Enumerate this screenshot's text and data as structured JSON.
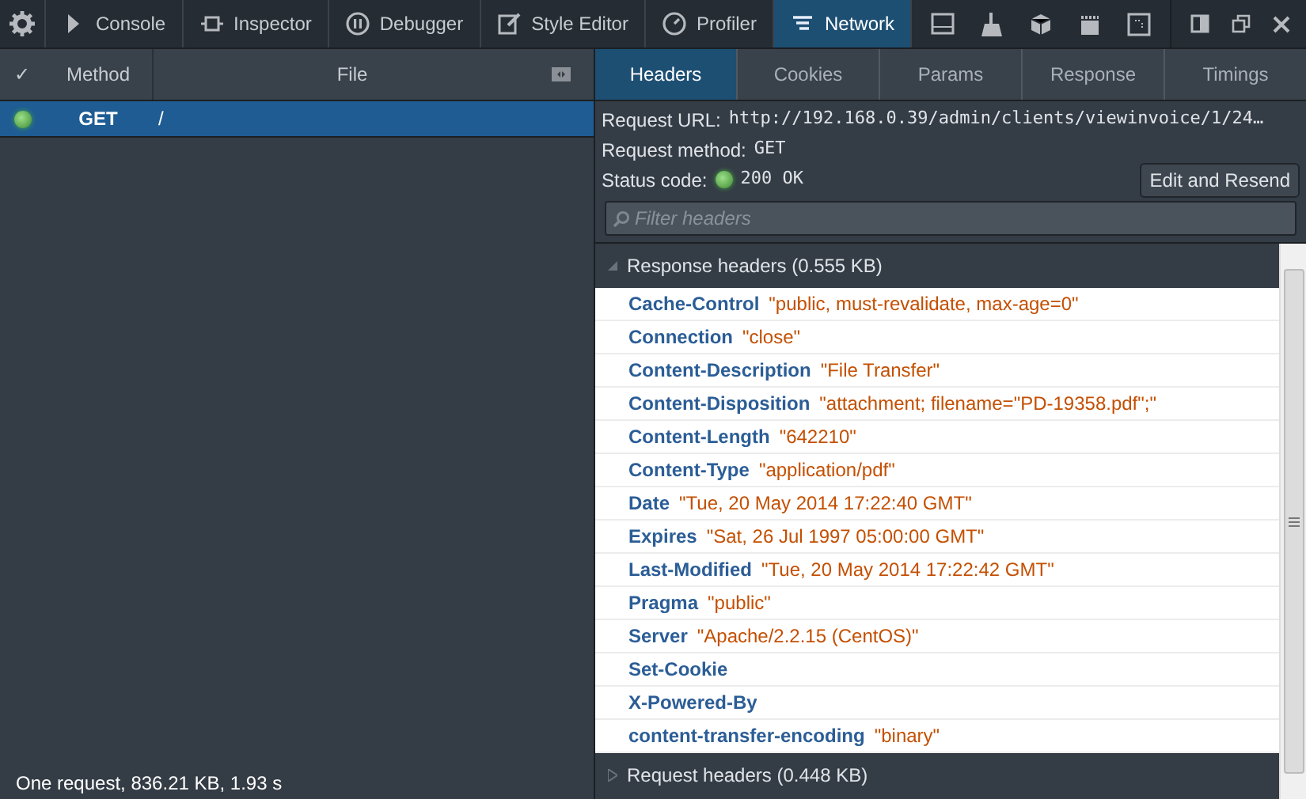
{
  "toolbar": {
    "tabs": [
      {
        "label": "Console",
        "selected": false
      },
      {
        "label": "Inspector",
        "selected": false
      },
      {
        "label": "Debugger",
        "selected": false
      },
      {
        "label": "Style Editor",
        "selected": false
      },
      {
        "label": "Profiler",
        "selected": false
      },
      {
        "label": "Network",
        "selected": true
      }
    ]
  },
  "requests": {
    "columns": [
      "Method",
      "File"
    ],
    "check_mark": "✓",
    "rows": [
      {
        "method": "GET",
        "file": "/",
        "selected": true
      }
    ],
    "status_bar": "One request, 836.21 KB, 1.93 s"
  },
  "details": {
    "tabs": [
      {
        "label": "Headers",
        "selected": true
      },
      {
        "label": "Cookies",
        "selected": false
      },
      {
        "label": "Params",
        "selected": false
      },
      {
        "label": "Response",
        "selected": false
      },
      {
        "label": "Timings",
        "selected": false
      }
    ],
    "summary": [
      {
        "label": "Request URL:",
        "value": "http://192.168.0.39/admin/clients/viewinvoice/1/24…"
      },
      {
        "label": "Request method:",
        "value": "GET"
      },
      {
        "label": "Status code:",
        "value": "200 OK"
      }
    ],
    "edit_button": "Edit and Resend",
    "filter": {
      "placeholder": "Filter headers"
    },
    "sections": [
      {
        "title": "Response headers (0.555 KB)",
        "expanded": true,
        "headers": [
          {
            "name": "Cache-Control",
            "value": "\"public, must-revalidate, max-age=0\""
          },
          {
            "name": "Connection",
            "value": "\"close\""
          },
          {
            "name": "Content-Description",
            "value": "\"File Transfer\""
          },
          {
            "name": "Content-Disposition",
            "value": "\"attachment; filename=\"PD-19358.pdf\";\""
          },
          {
            "name": "Content-Length",
            "value": "\"642210\""
          },
          {
            "name": "Content-Type",
            "value": "\"application/pdf\""
          },
          {
            "name": "Date",
            "value": "\"Tue, 20 May 2014 17:22:40 GMT\""
          },
          {
            "name": "Expires",
            "value": "\"Sat, 26 Jul 1997 05:00:00 GMT\""
          },
          {
            "name": "Last-Modified",
            "value": "\"Tue, 20 May 2014 17:22:42 GMT\""
          },
          {
            "name": "Pragma",
            "value": "\"public\""
          },
          {
            "name": "Server",
            "value": "\"Apache/2.2.15 (CentOS)\""
          },
          {
            "name": "Set-Cookie"
          },
          {
            "name": "X-Powered-By"
          },
          {
            "name": "content-transfer-encoding",
            "value": "\"binary\""
          }
        ]
      },
      {
        "title": "Request headers (0.448 KB)",
        "expanded": false
      }
    ]
  }
}
